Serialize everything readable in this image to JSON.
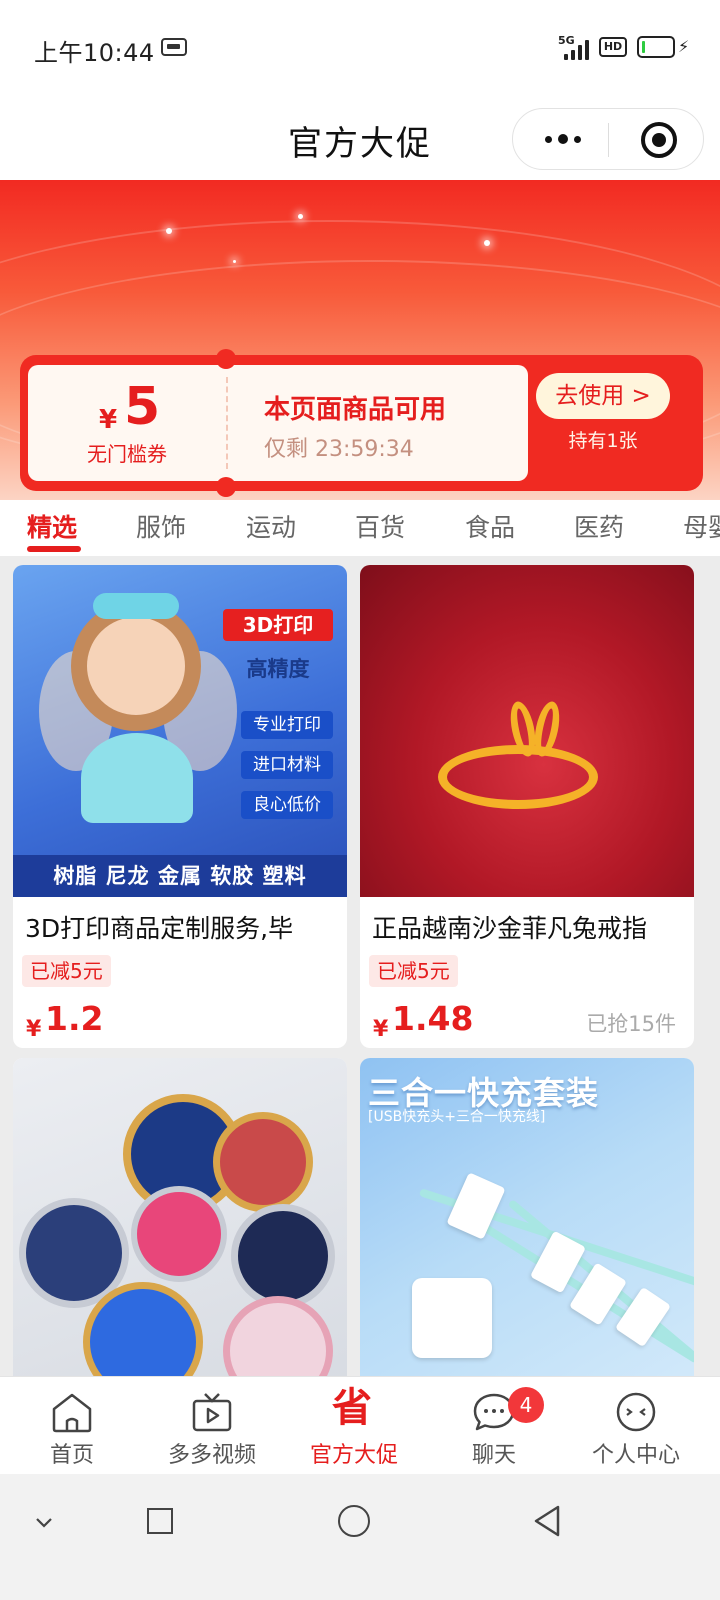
{
  "status_bar": {
    "time": "上午10:44",
    "network": "5G",
    "hd": "HD",
    "battery_level": 0.12
  },
  "header": {
    "title": "官方大促",
    "more_icon": "more-dots-icon",
    "close_icon": "miniprogram-close-icon"
  },
  "coupon": {
    "currency": "¥",
    "amount": "5",
    "kind": "无门槛券",
    "description": "本页面商品可用",
    "countdown": "仅剩 23:59:34",
    "button_label": "去使用 >",
    "held_count": "持有1张"
  },
  "tabs": [
    {
      "label": "精选",
      "active": true
    },
    {
      "label": "服饰",
      "active": false
    },
    {
      "label": "运动",
      "active": false
    },
    {
      "label": "百货",
      "active": false
    },
    {
      "label": "食品",
      "active": false
    },
    {
      "label": "医药",
      "active": false
    },
    {
      "label": "母婴",
      "active": false
    }
  ],
  "products": [
    {
      "title": "3D打印商品定制服务,毕",
      "badge": "已减5元",
      "currency": "¥",
      "price": "1.2",
      "sold": "",
      "image": {
        "tag_main": "3D打印",
        "tag_sub": "高精度",
        "features": [
          "专业打印",
          "进口材料",
          "良心低价"
        ],
        "materials": "树脂 尼龙 金属 软胶 塑料"
      }
    },
    {
      "title": "正品越南沙金菲凡兔戒指",
      "badge": "已减5元",
      "currency": "¥",
      "price": "1.48",
      "sold": "已抢15件"
    },
    {
      "title": "",
      "image": {}
    },
    {
      "title": "",
      "image": {
        "headline": "三合一快充套装",
        "subline": "[USB快充头+三合一快充线]"
      }
    }
  ],
  "bottom_nav": [
    {
      "label": "首页",
      "icon": "home-icon",
      "active": false
    },
    {
      "label": "多多视频",
      "icon": "video-icon",
      "active": false
    },
    {
      "label": "官方大促",
      "icon": "save-icon",
      "icon_text": "省",
      "active": true
    },
    {
      "label": "聊天",
      "icon": "chat-icon",
      "active": false,
      "badge": "4"
    },
    {
      "label": "个人中心",
      "icon": "profile-icon",
      "active": false
    }
  ],
  "system_nav": [
    "chevron-down-icon",
    "recents-icon",
    "home-circle-icon",
    "back-icon"
  ],
  "colors": {
    "accent": "#e51e1e",
    "banner_top": "#f22a22",
    "banner_bottom": "#fcd4c4"
  }
}
